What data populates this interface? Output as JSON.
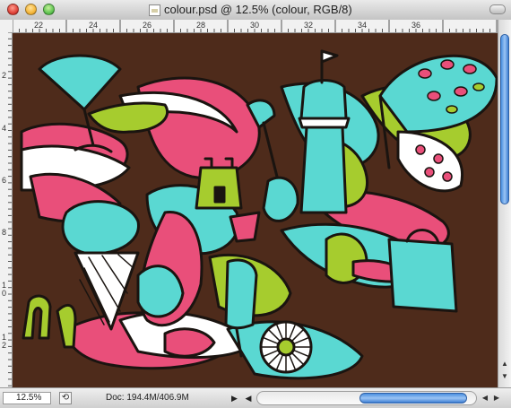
{
  "window": {
    "title": "colour.psd @ 12.5% (colour, RGB/8)"
  },
  "ruler_top": {
    "labels": [
      "22",
      "24",
      "26",
      "28",
      "30",
      "32",
      "34",
      "36"
    ]
  },
  "ruler_left": {
    "labels": [
      "2",
      "4",
      "6",
      "8",
      "1\n0",
      "1\n2"
    ]
  },
  "status": {
    "zoom": "12.5%",
    "doc_size": "Doc: 194.4M/406.9M"
  },
  "colors": {
    "canvas_bg": "#4e2b1b",
    "teal": "#5ad8d2",
    "pink": "#e94f7a",
    "lime": "#a6cc2e",
    "white": "#ffffff",
    "outline": "#1a1410"
  },
  "icons": {
    "close": "close-window-icon",
    "minimize": "minimize-window-icon",
    "zoom": "zoom-window-icon",
    "document": "psd-document-icon"
  }
}
